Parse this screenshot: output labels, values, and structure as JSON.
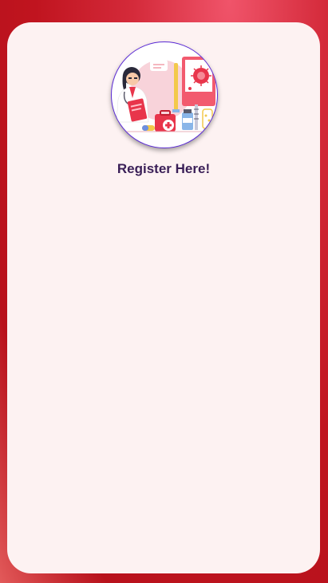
{
  "register": {
    "title": "Register Here!"
  },
  "illustration": {
    "icon": "doctor-illustration-icon"
  },
  "colors": {
    "background": "#c0141f",
    "card": "#fdf2f2",
    "title": "#3a1f57",
    "avatar_border": "#5b2bd6"
  }
}
